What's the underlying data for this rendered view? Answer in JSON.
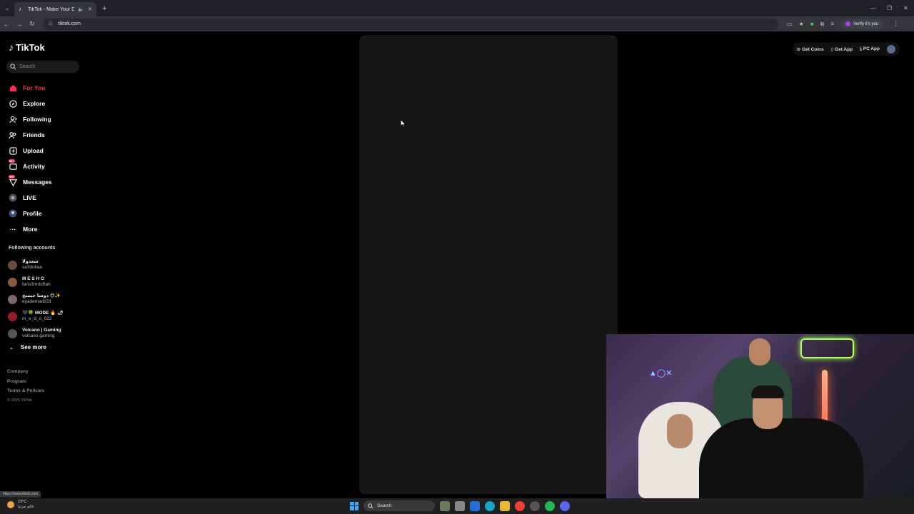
{
  "browser": {
    "tab_title": "TikTok - Make Your Day",
    "url": "tiktok.com",
    "verify_label": "Verify it's you",
    "status_url": "https://www.tiktok.com"
  },
  "tiktok": {
    "logo": "TikTok",
    "search_placeholder": "Search",
    "nav": [
      {
        "label": "For You"
      },
      {
        "label": "Explore"
      },
      {
        "label": "Following"
      },
      {
        "label": "Friends"
      },
      {
        "label": "Upload"
      },
      {
        "label": "Activity",
        "badge": "99+"
      },
      {
        "label": "Messages",
        "badge": "99+"
      },
      {
        "label": "LIVE"
      },
      {
        "label": "Profile"
      },
      {
        "label": "More"
      }
    ],
    "following_title": "Following accounts",
    "accounts": [
      {
        "display": "سعدولا",
        "handle": "sa3dollaa"
      },
      {
        "display": "M E S H O",
        "handle": "fans3mrtoftah"
      },
      {
        "display": "دوشا جيمنج 😍✨",
        "handle": "eyademad331"
      },
      {
        "display": "🖤🍀 MODE 🔥 🌶",
        "handle": "m_e_d_o_022"
      },
      {
        "display": "Volcano | Gaming",
        "handle": "volcano.gaming"
      }
    ],
    "see_more": "See more",
    "footer": {
      "company": "Company",
      "program": "Program",
      "terms": "Terms & Policies",
      "copyright": "© 2025 TikTok"
    },
    "topright": {
      "coins": "Get Coins",
      "app": "Get App",
      "pc": "PC App"
    }
  },
  "taskbar": {
    "temp": "23°C",
    "weather_text": "غائم جزئيا",
    "search": "Search"
  },
  "colors": {
    "accent": "#fe2c55",
    "sidebar_bg": "#000000",
    "video_bg": "#161616"
  }
}
